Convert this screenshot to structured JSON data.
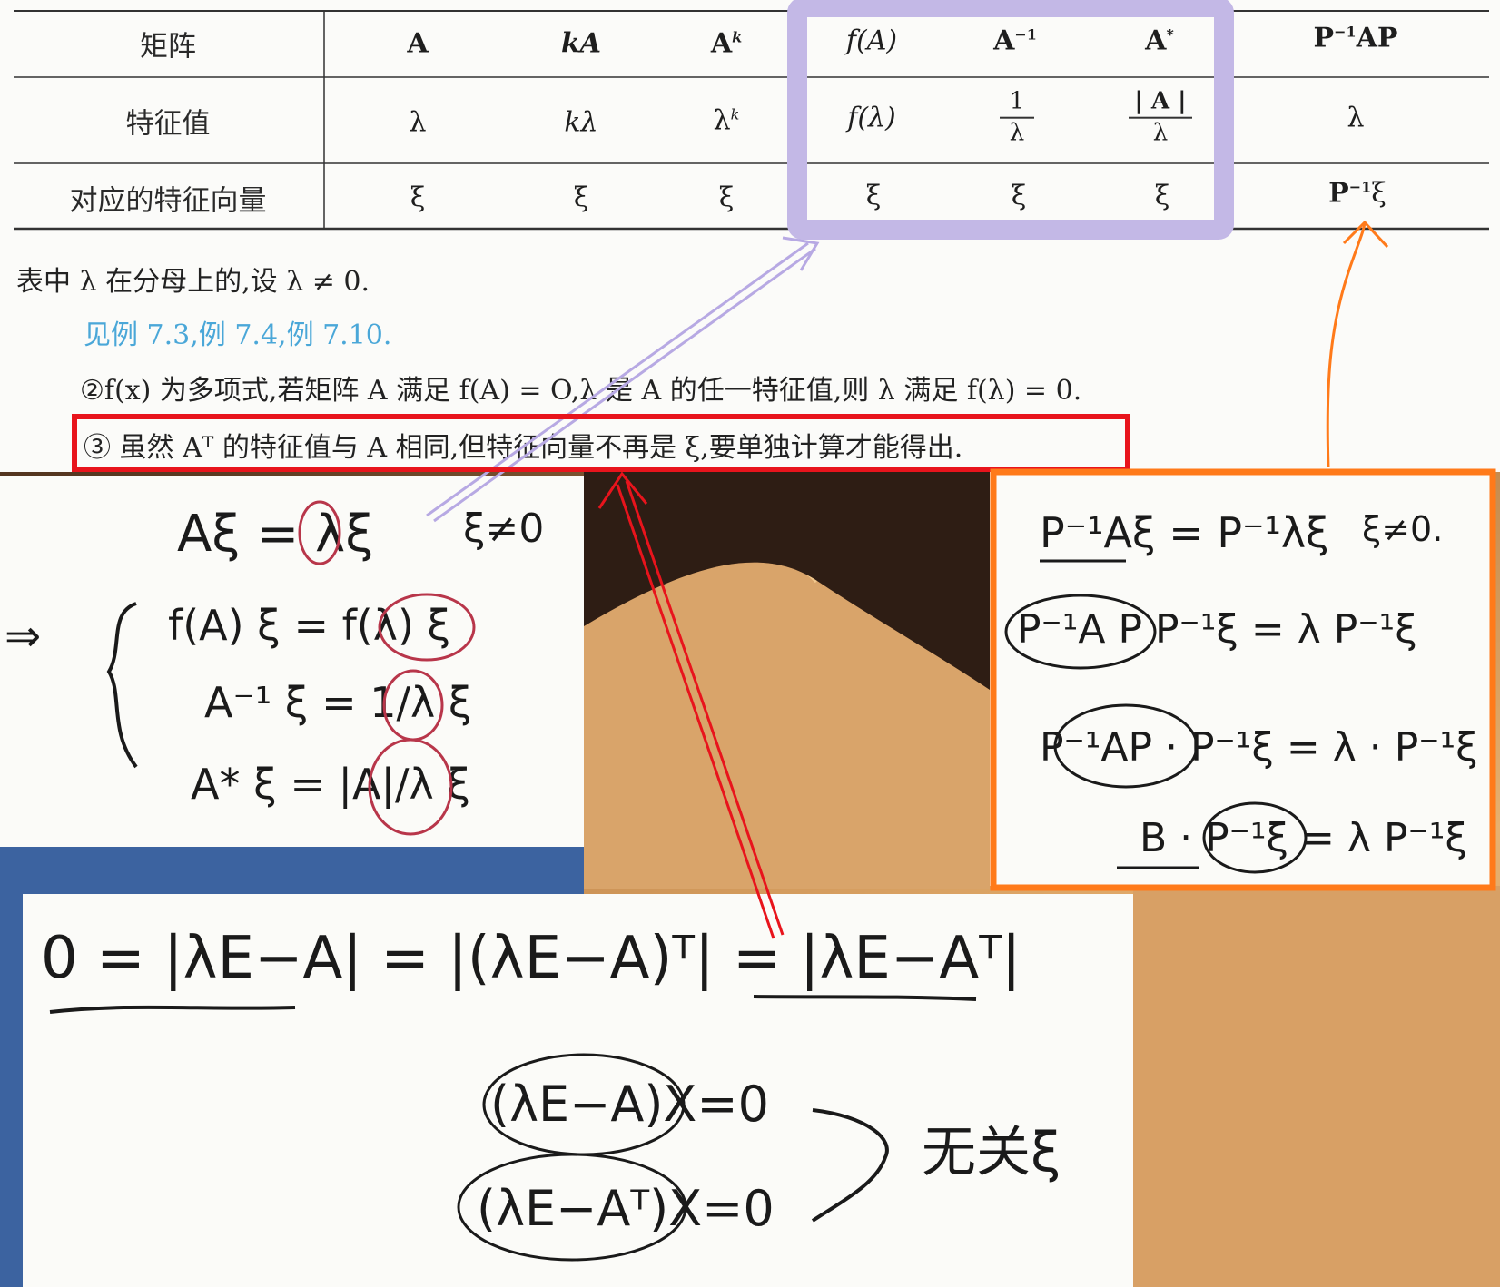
{
  "table": {
    "headers": [
      "矩阵",
      "A",
      "kA",
      "A^k",
      "f(A)",
      "A^-1",
      "A*",
      "P^-1AP"
    ],
    "header_display": {
      "row_label": "矩阵",
      "A": "A",
      "kA": "kA",
      "Ak_base": "A",
      "Ak_sup": "k",
      "fA": "f(A)",
      "Ainv_base": "A",
      "Ainv_sup": "−1",
      "Astar_base": "A",
      "Astar_sup": "*",
      "P": "P",
      "Pinv_sup": "−1",
      "AP": "AP"
    },
    "eigenvalue_row": {
      "label": "特征值",
      "A": "λ",
      "kA": "kλ",
      "Ak_base": "λ",
      "Ak_sup": "k",
      "fA": "f(λ)",
      "Ainv_num": "1",
      "Ainv_den": "λ",
      "Astar_num": "| A |",
      "Astar_den": "λ",
      "PAP": "λ"
    },
    "eigenvector_row": {
      "label": "对应的特征向量",
      "values": [
        "ξ",
        "ξ",
        "ξ",
        "ξ",
        "ξ",
        "ξ"
      ],
      "PAP_base": "P",
      "PAP_sup": "−1",
      "PAP_vec": "ξ"
    }
  },
  "notes": {
    "denominator_note": "表中 λ 在分母上的,设 λ ≠ 0.",
    "see_examples": "见例 7.3,例 7.4,例 7.10.",
    "note2": "②f(x) 为多项式,若矩阵 A 满足 f(A) = O,λ 是 A 的任一特征值,则 λ 满足 f(λ) = 0.",
    "note3": "③ 虽然 Aᵀ 的特征值与 A 相同,但特征向量不再是 ξ,要单独计算才能得出."
  },
  "handwriting": {
    "left_panel": {
      "line1": "Aξ = λξ",
      "line1_cond": "ξ≠0",
      "implies": "⇒",
      "f_line": "f(A) ξ = f(λ) ξ",
      "inv_line": "A⁻¹ ξ = 1/λ ξ",
      "star_line": "A* ξ = |A|/λ ξ"
    },
    "right_panel": {
      "line1": "P⁻¹Aξ = P⁻¹λξ",
      "line1_cond": "ξ≠0.",
      "line2": "P⁻¹A P P⁻¹ξ = λ P⁻¹ξ",
      "line3": "P⁻¹AP · P⁻¹ξ = λ · P⁻¹ξ",
      "line4": "B · P⁻¹ξ = λ P⁻¹ξ"
    },
    "bottom_panel": {
      "line1": "0 = |λE−A| = |(λE−A)ᵀ| = |λE−Aᵀ|",
      "sys1": "(λE−A)X=0",
      "sys2": "(λE−Aᵀ)X=0",
      "conclusion": "无关ξ"
    }
  },
  "colors": {
    "purple_box": "#c3b8e6",
    "red_box": "#e8141c",
    "orange_box": "#ff7a1a",
    "link_blue": "#4aa7d8",
    "circle_red": "#b8364a"
  }
}
